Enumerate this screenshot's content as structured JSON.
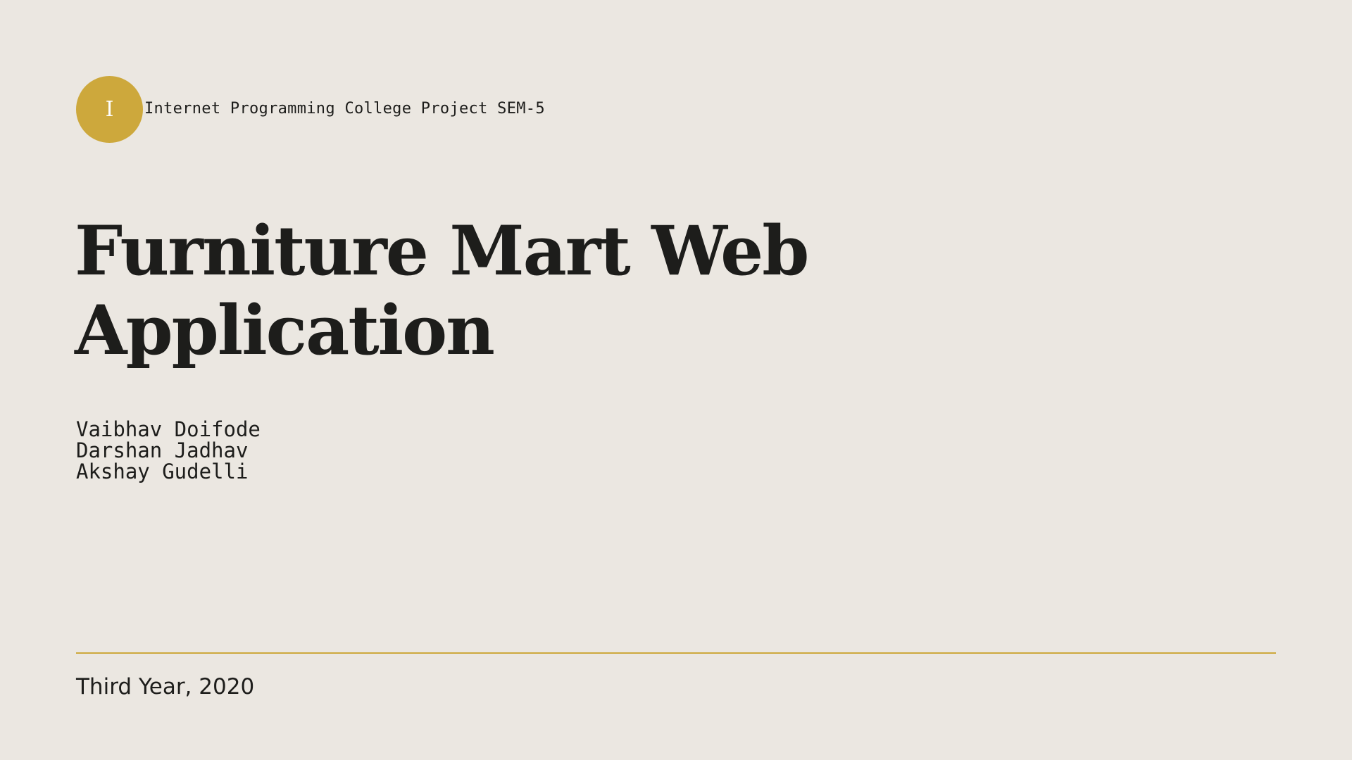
{
  "header": {
    "badge_letter": "I",
    "project_label": "Internet Programming College Project SEM-5"
  },
  "title": {
    "line1": "Furniture Mart Web",
    "line2": "Application"
  },
  "authors": [
    "Vaibhav Doifode",
    "Darshan Jadhav",
    "Akshay Gudelli"
  ],
  "footer": {
    "text": "Third Year, 2020"
  },
  "colors": {
    "background": "#ebe7e1",
    "accent": "#cda83c",
    "text": "#1d1d1b"
  }
}
